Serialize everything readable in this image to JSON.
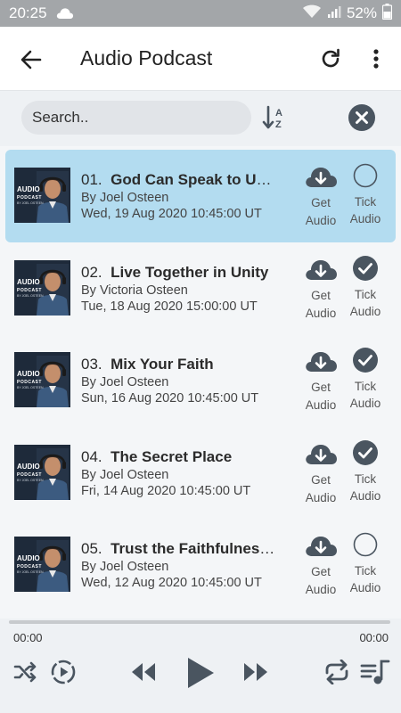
{
  "status_bar": {
    "time": "20:25",
    "battery": "52%"
  },
  "app_bar": {
    "title": "Audio Podcast"
  },
  "search": {
    "placeholder": "Search.."
  },
  "thumbnail": {
    "line1": "AUDIO",
    "line2": "PODCAST",
    "line3": "BY JOEL OSTEEN"
  },
  "episodes": [
    {
      "num": "01.",
      "title": "God Can Speak to Us Through",
      "author": "By Joel Osteen",
      "date": "Wed, 19 Aug 2020 10:45:00 UT",
      "get_label_1": "Get",
      "get_label_2": "Audio",
      "tick_label_1": "Tick",
      "tick_label_2": "Audio",
      "ticked": false,
      "selected": true
    },
    {
      "num": "02.",
      "title": "Live Together in Unity",
      "author": "By Victoria Osteen",
      "date": "Tue, 18 Aug 2020 15:00:00 UT",
      "get_label_1": "Get",
      "get_label_2": "Audio",
      "tick_label_1": "Tick",
      "tick_label_2": "Audio",
      "ticked": true,
      "selected": false
    },
    {
      "num": "03.",
      "title": "Mix Your Faith",
      "author": "By Joel Osteen",
      "date": "Sun, 16 Aug 2020 10:45:00 UT",
      "get_label_1": "Get",
      "get_label_2": "Audio",
      "tick_label_1": "Tick",
      "tick_label_2": "Audio",
      "ticked": true,
      "selected": false
    },
    {
      "num": "04.",
      "title": "The Secret Place",
      "author": "By Joel Osteen",
      "date": "Fri, 14 Aug 2020 10:45:00 UT",
      "get_label_1": "Get",
      "get_label_2": "Audio",
      "tick_label_1": "Tick",
      "tick_label_2": "Audio",
      "ticked": true,
      "selected": false
    },
    {
      "num": "05.",
      "title": "Trust the Faithfulness of God",
      "author": "By Joel Osteen",
      "date": "Wed, 12 Aug 2020 10:45:00 UT",
      "get_label_1": "Get",
      "get_label_2": "Audio",
      "tick_label_1": "Tick",
      "tick_label_2": "Audio",
      "ticked": false,
      "selected": false
    }
  ],
  "player": {
    "elapsed": "00:00",
    "duration": "00:00",
    "progress": 0
  },
  "colors": {
    "selected_row": "#b3dcf0",
    "icon": "#4a5560",
    "status_bar": "#a3a6a9"
  },
  "icons": {
    "back": "arrow-left-icon",
    "refresh": "refresh-icon",
    "more": "more-vertical-icon",
    "sort": "sort-alpha-icon",
    "clear": "close-circle-icon",
    "download": "cloud-download-icon",
    "tick": "check-circle-icon",
    "shuffle": "shuffle-icon",
    "autoplay": "play-circle-dashed-icon",
    "prev": "rewind-icon",
    "play": "play-icon",
    "next": "fast-forward-icon",
    "repeat": "repeat-icon",
    "playlist": "playlist-music-icon"
  }
}
